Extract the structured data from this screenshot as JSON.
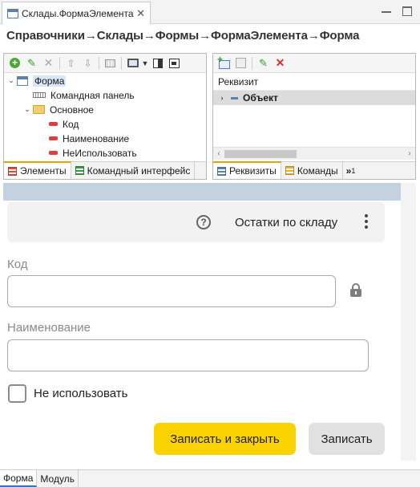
{
  "editor_tab": {
    "title": "Склады.ФормаЭлемента",
    "close": "✕"
  },
  "breadcrumb": "Справочники→Склады→Формы→ФормаЭлемента→Форма",
  "elements_tree": [
    {
      "label": "Форма",
      "icon": "form-icon",
      "caret": "⌄",
      "selected": true
    },
    {
      "label": "Командная панель",
      "icon": "command-panel-icon"
    },
    {
      "label": "Основное",
      "icon": "folder-icon",
      "caret": "⌄"
    },
    {
      "label": "Код",
      "icon": "field-icon"
    },
    {
      "label": "Наименование",
      "icon": "field-icon"
    },
    {
      "label": "НеИспользовать",
      "icon": "field-icon"
    }
  ],
  "left_tabs": {
    "elements": "Элементы",
    "command_interface": "Командный интерфейс"
  },
  "requisites": {
    "header": "Реквизит",
    "row_label": "Объект",
    "row_caret": "›"
  },
  "right_tabs": {
    "requisites": "Реквизиты",
    "commands": "Команды",
    "more": "»",
    "more_count": "1"
  },
  "preview": {
    "help": "?",
    "command_title": "Остатки по складу",
    "code_label": "Код",
    "name_label": "Наименование",
    "checkbox_label": "Не использовать",
    "save_close_button": "Записать и закрыть",
    "save_button": "Записать"
  },
  "editor_tabs": {
    "form": "Форма",
    "module": "Модуль"
  },
  "colors": {
    "primary_button": "#fad200",
    "preview_header": "#c4d2df",
    "active_tab_accent": "#e9a200"
  }
}
